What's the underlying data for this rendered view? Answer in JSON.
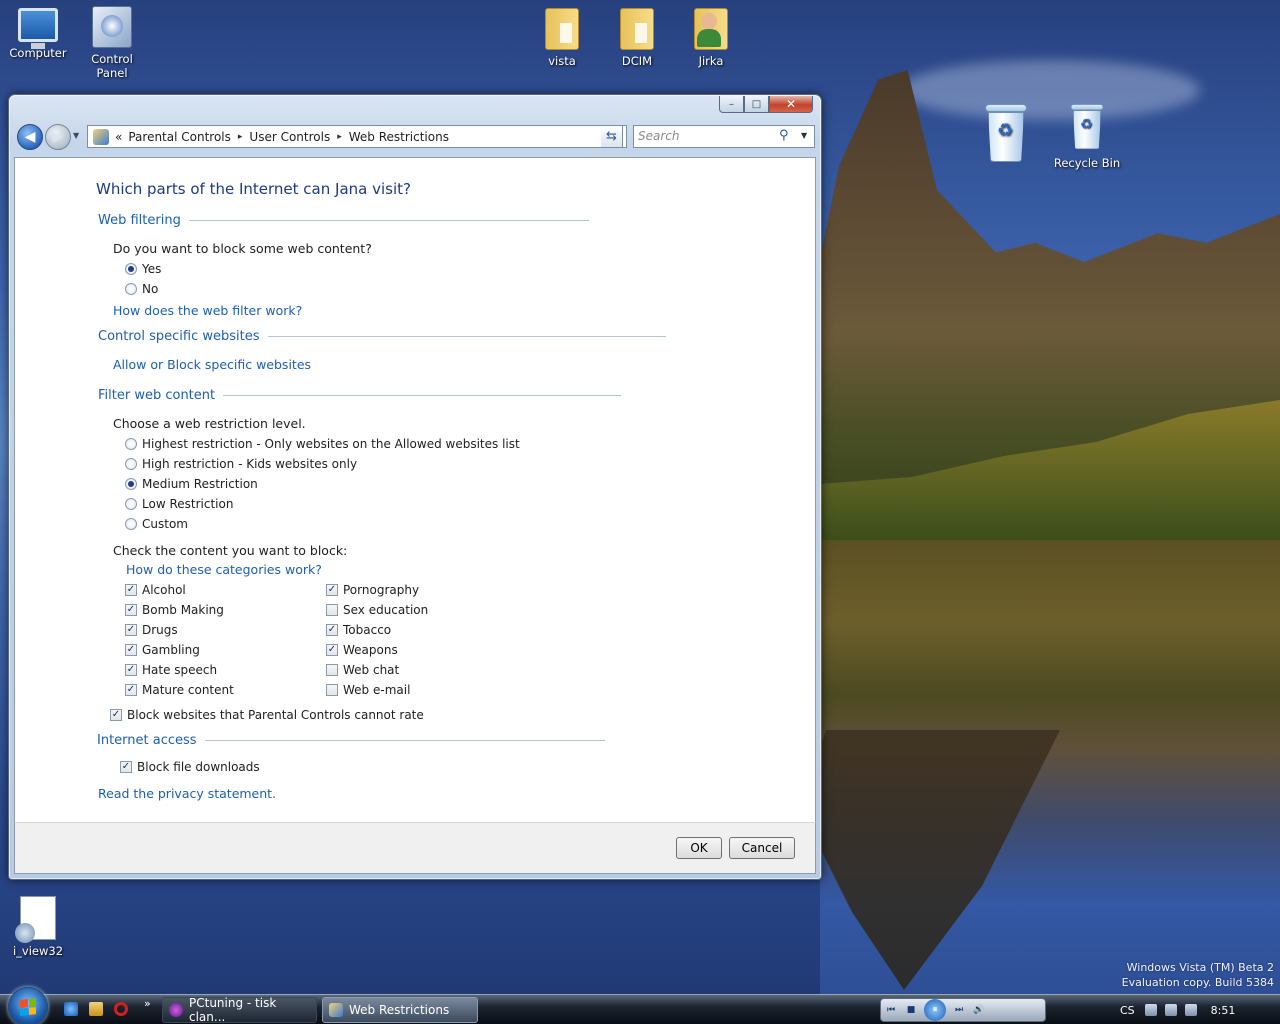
{
  "desktop": {
    "icons": [
      {
        "label_line1": "Computer",
        "label_line2": ""
      },
      {
        "label_line1": "Control",
        "label_line2": "Panel"
      },
      {
        "label_line1": "vista",
        "label_line2": ""
      },
      {
        "label_line1": "DCIM",
        "label_line2": ""
      },
      {
        "label_line1": "Jirka",
        "label_line2": ""
      },
      {
        "label_line1": "Recycle Bin",
        "label_line2": ""
      },
      {
        "label_line1": "i_view32",
        "label_line2": ""
      }
    ],
    "watermark_line1": "Windows Vista (TM) Beta 2",
    "watermark_line2": "Evaluation copy. Build 5384"
  },
  "window": {
    "caption_buttons": {
      "minimize": "–",
      "maximize": "□",
      "close": "✕"
    },
    "address": {
      "back_symbol": "◀",
      "forward_symbol": "▶",
      "overflow": "«",
      "breadcrumbs": [
        "Parental Controls",
        "User Controls",
        "Web Restrictions"
      ],
      "separator": "▸",
      "dropdown_symbol": "▼",
      "refresh_symbol": "⇆"
    },
    "search": {
      "placeholder": "Search",
      "icon_symbol": "⚲",
      "dropdown_symbol": "▼"
    },
    "heading": "Which parts of the Internet can Jana visit?",
    "web_filtering": {
      "title": "Web filtering",
      "question": "Do you want to block some web content?",
      "options": [
        {
          "label": "Yes",
          "selected": true
        },
        {
          "label": "No",
          "selected": false
        }
      ],
      "help_link": "How does the web filter work?"
    },
    "control_sites": {
      "title": "Control specific websites",
      "link": "Allow or Block specific websites"
    },
    "filter_content": {
      "title": "Filter web content",
      "question": "Choose a web restriction level.",
      "levels": [
        {
          "label": "Highest restriction - Only websites on the Allowed websites list",
          "selected": false
        },
        {
          "label": "High restriction - Kids websites only",
          "selected": false
        },
        {
          "label": "Medium Restriction",
          "selected": true
        },
        {
          "label": "Low Restriction",
          "selected": false
        },
        {
          "label": "Custom",
          "selected": false
        }
      ],
      "check_prompt": "Check the content you want to block:",
      "categories_link": "How do these categories work?",
      "left_categories": [
        {
          "label": "Alcohol",
          "checked": true
        },
        {
          "label": "Bomb Making",
          "checked": true
        },
        {
          "label": "Drugs",
          "checked": true
        },
        {
          "label": "Gambling",
          "checked": true
        },
        {
          "label": "Hate speech",
          "checked": true
        },
        {
          "label": "Mature content",
          "checked": true
        }
      ],
      "right_categories": [
        {
          "label": "Pornography",
          "checked": true
        },
        {
          "label": "Sex education",
          "checked": false
        },
        {
          "label": "Tobacco",
          "checked": true
        },
        {
          "label": "Weapons",
          "checked": true
        },
        {
          "label": "Web chat",
          "checked": false
        },
        {
          "label": "Web e-mail",
          "checked": false
        }
      ],
      "block_unrated": {
        "label": "Block websites that Parental Controls cannot rate",
        "checked": true
      }
    },
    "internet_access": {
      "title": "Internet access",
      "block_downloads": {
        "label": "Block file downloads",
        "checked": true
      }
    },
    "privacy_link": "Read the privacy statement.",
    "ok_label": "OK",
    "cancel_label": "Cancel"
  },
  "taskbar": {
    "more_symbol": "»",
    "tasks": [
      "PCtuning - tisk clan...",
      "Web Restrictions"
    ],
    "media_symbols": {
      "prev": "⏮",
      "stop": "■",
      "play": "⏸",
      "next": "⏭",
      "volume": "🔊"
    },
    "language": "CS",
    "clock": "8:51"
  },
  "colors": {
    "link": "#1c5fb0",
    "heading": "#1c3a84",
    "close_button": "#c2432c"
  }
}
